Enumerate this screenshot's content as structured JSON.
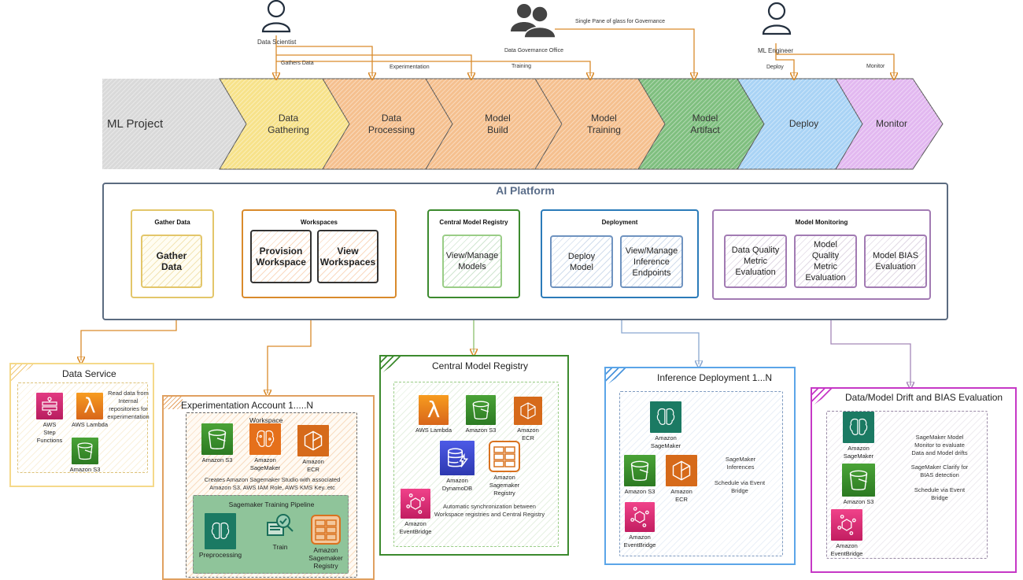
{
  "actors": {
    "data_scientist": "Data Scientist",
    "governance_office": "Data Governance Office",
    "ml_engineer": "ML Engineer"
  },
  "flows": {
    "gathers_data": "Gathers Data",
    "experimentation": "Experimentation",
    "training": "Training",
    "governance": "Single Pane of glass for Governance",
    "deploy": "Deploy",
    "monitor": "Monitor"
  },
  "pipeline": [
    {
      "label": "ML Project",
      "fill": "#d9d9d9"
    },
    {
      "label": "Data\nGathering",
      "fill": "#f7e28a"
    },
    {
      "label": "Data\nProcessing",
      "fill": "#f5c08f"
    },
    {
      "label": "Model\nBuild",
      "fill": "#f5c08f"
    },
    {
      "label": "Model\nTraining",
      "fill": "#f5c08f"
    },
    {
      "label": "Model\nArtifact",
      "fill": "#7fbf7f"
    },
    {
      "label": "Deploy",
      "fill": "#a9d3f5"
    },
    {
      "label": "Monitor",
      "fill": "#e2b8f0"
    }
  ],
  "platform": {
    "title": "AI Platform",
    "groups": {
      "gather": {
        "title": "Gather Data",
        "cards": [
          "Gather\nData"
        ]
      },
      "workspaces": {
        "title": "Workspaces",
        "cards": [
          "Provision\nWorkspace",
          "View\nWorkspaces"
        ]
      },
      "registry": {
        "title": "Central Model Registry",
        "cards": [
          "View/Manage\nModels"
        ]
      },
      "deployment": {
        "title": "Deployment",
        "cards": [
          "Deploy\nModel",
          "View/Manage\nInference\nEndpoints"
        ]
      },
      "monitoring": {
        "title": "Model Monitoring",
        "cards": [
          "Data Quality\nMetric\nEvaluation",
          "Model\nQuality\nMetric\nEvaluation",
          "Model BIAS\nEvaluation"
        ]
      }
    }
  },
  "accounts": {
    "data_service": {
      "title": "Data Service",
      "services": [
        "AWS\nStep Functions",
        "AWS Lambda",
        "Amazon S3"
      ],
      "note": "Read data from\nInternal\nrepositories for\nexperimentation"
    },
    "experimentation": {
      "title": "Experimentation Account 1.....N",
      "workspace_label": "Workspace",
      "services": [
        "Amazon S3",
        "Amazon\nSageMaker",
        "Amazon\nECR"
      ],
      "note": "Creates Amazon Sagemaker Studio with associated\nAmazon S3, AWS IAM Role, AWS KMS Key..etc",
      "pipeline": {
        "title": "Sagemaker Training Pipeline",
        "steps": [
          "Preprocessing",
          "Train",
          "Amazon\nSagemaker\nRegistry"
        ]
      }
    },
    "central_registry": {
      "title": "Central Model Registry",
      "services": [
        "AWS Lambda",
        "Amazon S3",
        "Amazon\nECR",
        "Amazon\nDynamoDB",
        "Amazon\nSagemaker\nRegistry",
        "Amazon\nEventBridge"
      ],
      "note": "Automatic synchronization between\nWorkspace registries and Central Registry"
    },
    "inference": {
      "title": "Inference Deployment 1...N",
      "services": [
        "Amazon\nSageMaker",
        "Amazon S3",
        "Amazon\nECR",
        "Amazon\nEventBridge"
      ],
      "note1": "SageMaker\nInferences",
      "note2": "Schedule via Event\nBridge"
    },
    "drift": {
      "title": "Data/Model Drift and BIAS Evaluation",
      "services": [
        "Amazon\nSageMaker",
        "Amazon S3",
        "Amazon\nEventBridge"
      ],
      "note1": "SageMaker Model\nMonitor to evaluate\nData and Model drifts",
      "note2": "SageMaker Clarify for\nBIAS detection",
      "note3": "Schedule via Event\nBridge"
    }
  },
  "colors": {
    "orange_arrow": "#d98a2b",
    "lambda": "#e8761b",
    "s3": "#3b8a2b",
    "sagemaker": "#1b7a63",
    "ecr": "#d66a1a",
    "dynamodb": "#3b48cc",
    "eventbridge": "#d6246a",
    "stepfunctions": "#d6246a"
  }
}
